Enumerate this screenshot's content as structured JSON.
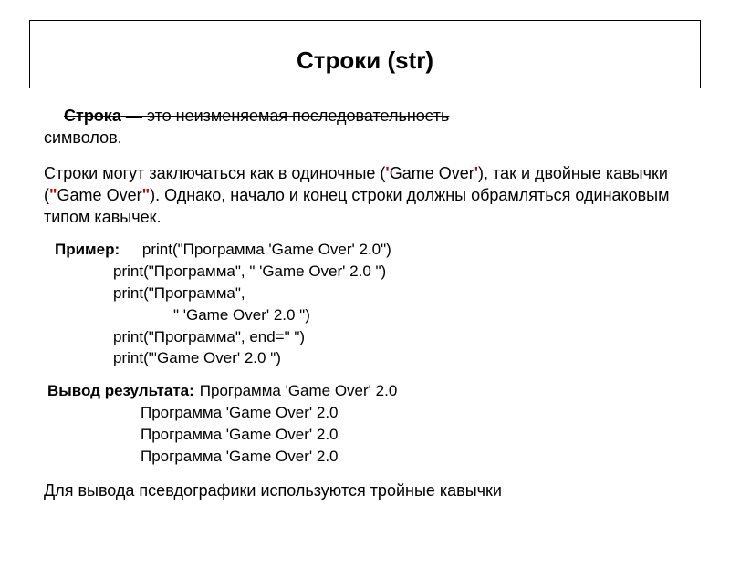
{
  "title": "Строки (str)",
  "para1_bold": "Строка",
  "para1_rest_strike": " — это неизменяемая последовательность",
  "para1_line2": "символов.",
  "para2_a": "Строки могут заключаться как в одиночные (",
  "q1": "'",
  "para2_b": "Game Over",
  "q2": "'",
  "para2_c": "), так и двойные кавычки (",
  "q3": "\"",
  "para2_d": "Game Over",
  "q4": "\"",
  "para2_e": "). Однако, начало и конец строки должны обрамляться одинаковым типом кавычек.",
  "example_label": "Пример:",
  "code": {
    "l1": "print(\"Программа 'Game Over' 2.0\")",
    "l2": "print(\"Программа\", \" 'Game Over' 2.0 \")",
    "l3": "print(\"Программа\",",
    "l4": "\" 'Game Over' 2.0 \")",
    "l5": "print(\"Программа\", end=\" \")",
    "l6": "print(\"'Game Over' 2.0 \")"
  },
  "output_label": "Вывод результата:",
  "out": {
    "l1": "Программа 'Game Over' 2.0",
    "l2": "Программа  'Game Over' 2.0",
    "l3": "Программа  'Game Over' 2.0",
    "l4": "Программа 'Game Over' 2.0"
  },
  "para3": "Для вывода псевдографики используются тройные кавычки"
}
